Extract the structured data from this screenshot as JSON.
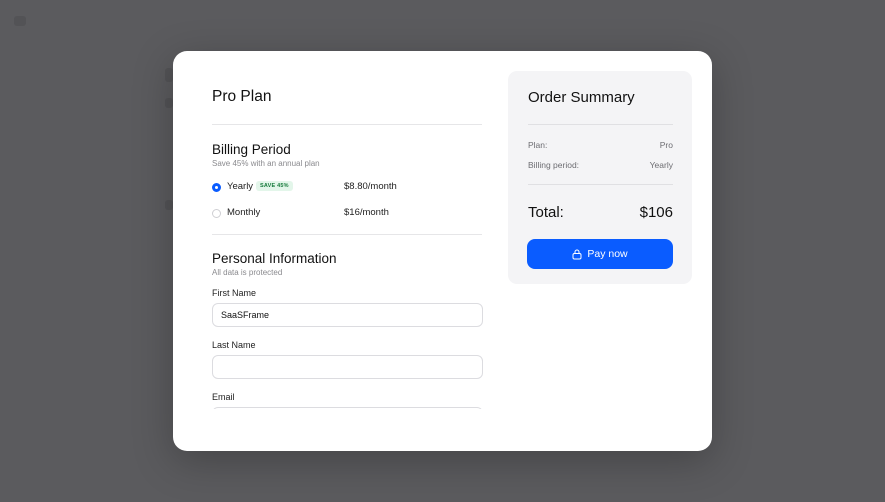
{
  "plan": {
    "title": "Pro Plan",
    "swap_icon": "swap-arrows-icon"
  },
  "billing": {
    "title": "Billing Period",
    "subtitle": "Save 45% with an annual plan",
    "options": [
      {
        "label": "Yearly",
        "badge": "SAVE 45%",
        "price": "$8.80/month",
        "selected": true
      },
      {
        "label": "Monthly",
        "badge": "",
        "price": "$16/month",
        "selected": false
      }
    ]
  },
  "personal": {
    "title": "Personal Information",
    "subtitle": "All data is protected",
    "first_name": {
      "label": "First Name",
      "value": "SaaSFrame",
      "placeholder": ""
    },
    "last_name": {
      "label": "Last Name",
      "value": "",
      "placeholder": ""
    },
    "email": {
      "label": "Email",
      "value": "",
      "placeholder": ""
    }
  },
  "summary": {
    "title": "Order Summary",
    "rows": [
      {
        "label": "Plan:",
        "value": "Pro"
      },
      {
        "label": "Billing period:",
        "value": "Yearly"
      }
    ],
    "total_label": "Total:",
    "total_value": "$106",
    "pay_label": "Pay now",
    "pay_icon": "lock-icon"
  },
  "colors": {
    "accent": "#0a5cff",
    "badge_bg": "#e3f6ea",
    "badge_text": "#167a3b",
    "overlay": "#5b5b5e"
  }
}
